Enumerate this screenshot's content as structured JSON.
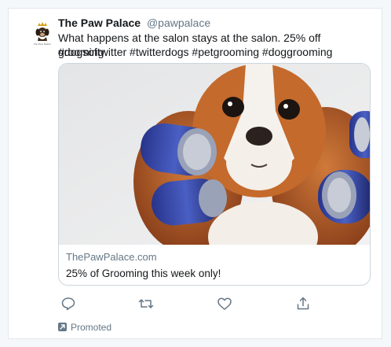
{
  "tweet": {
    "display_name": "The Paw Palace",
    "handle": "@pawpalace",
    "text": "What happens at the salon stays at the salon. 25% off grooming",
    "hashtags": "#dogsoftwitter #twitterdogs #petgrooming #doggrooming",
    "avatar_icon": "dog-crown-logo-icon",
    "avatar_logo_text": "The Paw Palace"
  },
  "link_card": {
    "image_alt": "cavalier-spaniel-with-hair-rollers",
    "domain": "ThePawPalace.com",
    "title": "25% of Grooming this week only!"
  },
  "actions": [
    {
      "icon": "reply-icon"
    },
    {
      "icon": "retweet-icon"
    },
    {
      "icon": "like-icon"
    },
    {
      "icon": "share-icon"
    }
  ],
  "promoted": {
    "icon": "promoted-arrow-icon",
    "label": "Promoted"
  },
  "colors": {
    "text": "#14171a",
    "secondary": "#657786",
    "border": "#e1e8ed",
    "background": "#f5f8fa"
  }
}
